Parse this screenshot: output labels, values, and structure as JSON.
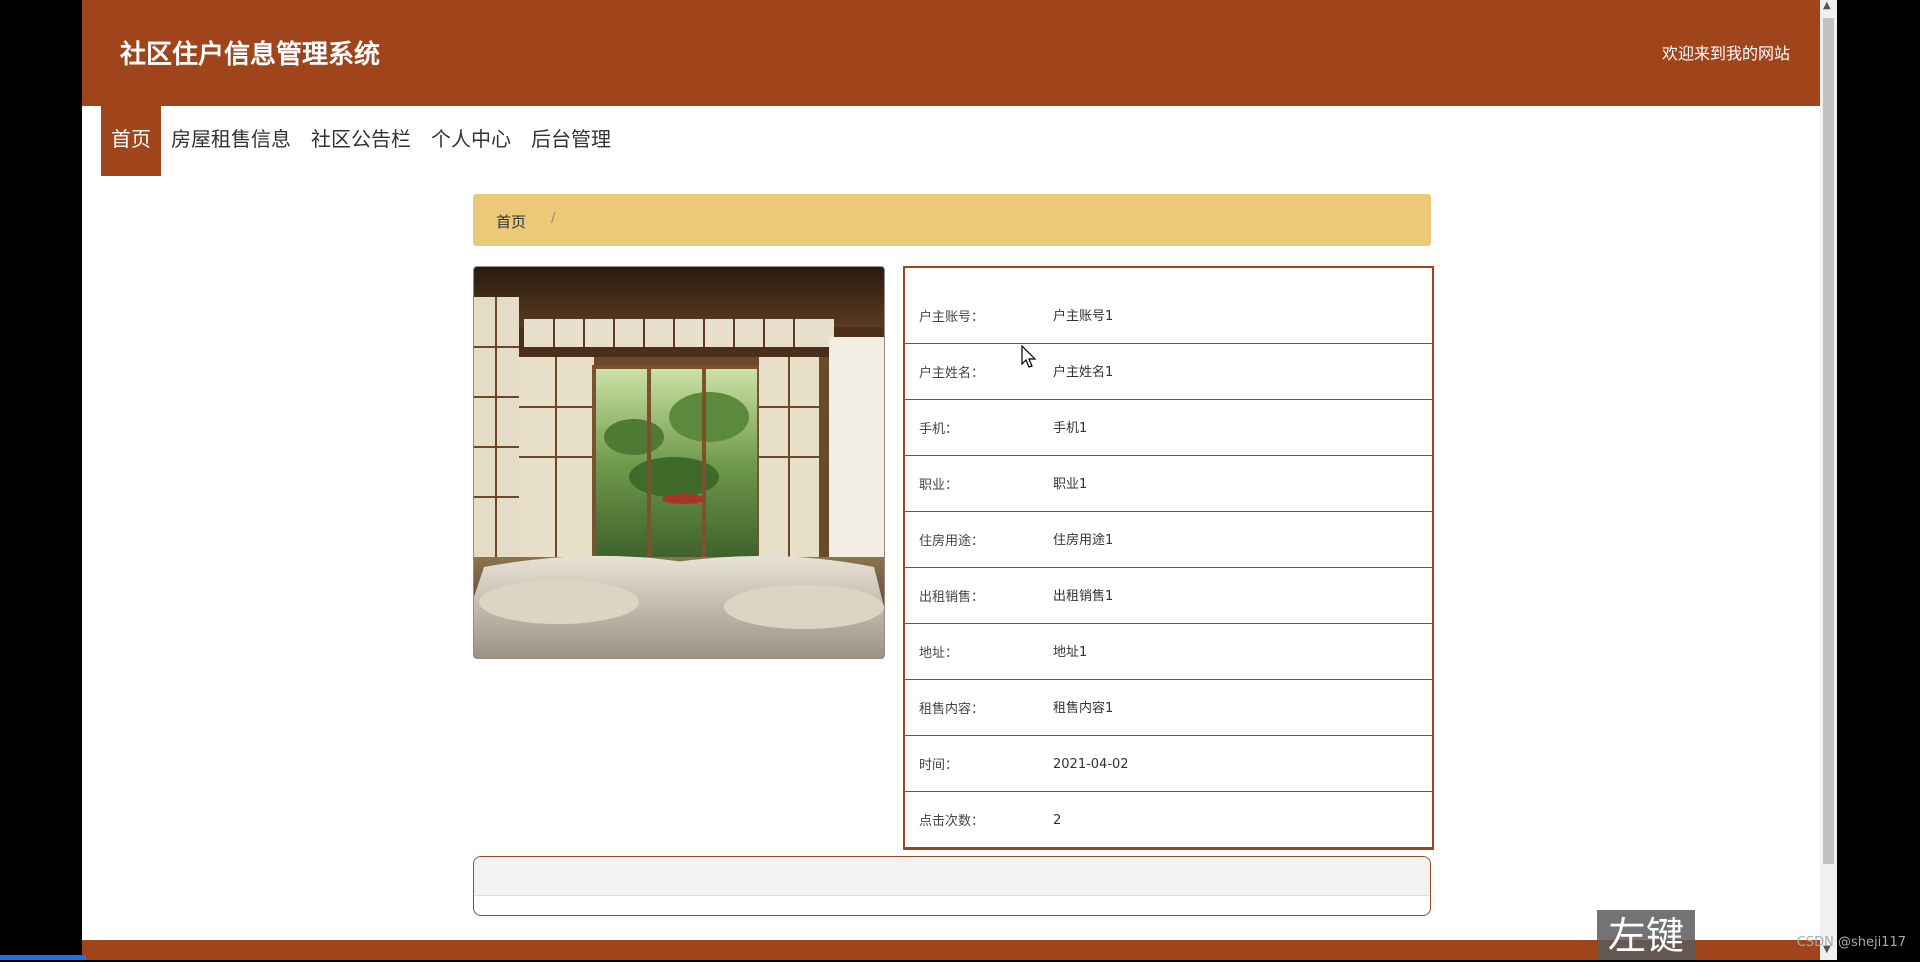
{
  "header": {
    "site_title": "社区住户信息管理系统",
    "welcome": "欢迎来到我的网站"
  },
  "nav": {
    "items": [
      {
        "label": "首页",
        "active": true
      },
      {
        "label": "房屋租售信息"
      },
      {
        "label": "社区公告栏"
      },
      {
        "label": "个人中心"
      },
      {
        "label": "后台管理"
      }
    ]
  },
  "breadcrumb": {
    "home": "首页",
    "separator": "/"
  },
  "photo": {
    "icon": "house-room-photo"
  },
  "details": [
    {
      "label": "户主账号：",
      "value": "户主账号1"
    },
    {
      "label": "户主姓名：",
      "value": "户主姓名1"
    },
    {
      "label": "手机：",
      "value": "手机1"
    },
    {
      "label": "职业：",
      "value": "职业1"
    },
    {
      "label": "住房用途：",
      "value": "住房用途1"
    },
    {
      "label": "出租销售：",
      "value": "出租销售1"
    },
    {
      "label": "地址：",
      "value": "地址1"
    },
    {
      "label": "租售内容：",
      "value": "租售内容1"
    },
    {
      "label": "时间：",
      "value": "2021-04-02"
    },
    {
      "label": "点击次数：",
      "value": "2"
    }
  ],
  "overlay": {
    "hint": "左键",
    "watermark": "CSDN @sheji117"
  },
  "colors": {
    "brand": "#a0441c",
    "breadcrumb_bg": "#ebc977"
  }
}
